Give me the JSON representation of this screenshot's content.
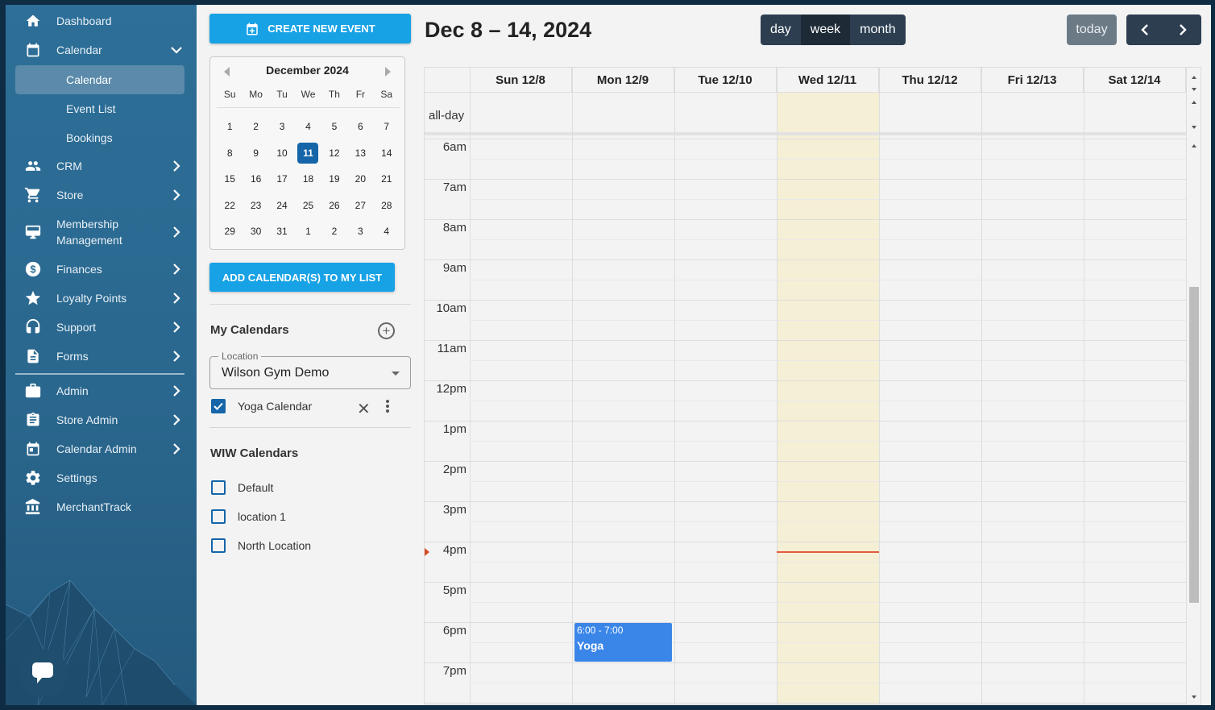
{
  "sidebar": {
    "items": [
      {
        "label": "Dashboard",
        "icon": "home-icon"
      },
      {
        "label": "Calendar",
        "icon": "calendar-icon",
        "expanded": true,
        "children": [
          {
            "label": "Calendar",
            "active": true
          },
          {
            "label": "Event List"
          },
          {
            "label": "Bookings"
          }
        ]
      },
      {
        "label": "CRM",
        "icon": "people-icon"
      },
      {
        "label": "Store",
        "icon": "cart-icon"
      },
      {
        "label": "Membership Management",
        "label_line1": "Membership",
        "label_line2": "Management",
        "icon": "monitor-icon"
      },
      {
        "label": "Finances",
        "icon": "dollar-circle-icon"
      },
      {
        "label": "Loyalty Points",
        "icon": "star-icon"
      },
      {
        "label": "Support",
        "icon": "headset-icon"
      },
      {
        "label": "Forms",
        "icon": "document-icon"
      },
      {
        "label": "Admin",
        "icon": "briefcase-icon"
      },
      {
        "label": "Store Admin",
        "icon": "clipboard-icon"
      },
      {
        "label": "Calendar Admin",
        "icon": "calendar-edit-icon"
      },
      {
        "label": "Settings",
        "icon": "gear-icon"
      },
      {
        "label": "MerchantTrack",
        "icon": "bank-icon"
      }
    ]
  },
  "toolbar": {
    "create_event_label": "CREATE NEW EVENT",
    "add_calendars_label": "ADD CALENDAR(S) TO MY LIST"
  },
  "mini_calendar": {
    "month_label": "December 2024",
    "weekdays": [
      "Su",
      "Mo",
      "Tu",
      "We",
      "Th",
      "Fr",
      "Sa"
    ],
    "days": [
      "1",
      "2",
      "3",
      "4",
      "5",
      "6",
      "7",
      "8",
      "9",
      "10",
      "11",
      "12",
      "13",
      "14",
      "15",
      "16",
      "17",
      "18",
      "19",
      "20",
      "21",
      "22",
      "23",
      "24",
      "25",
      "26",
      "27",
      "28",
      "29",
      "30",
      "31",
      "1",
      "2",
      "3",
      "4"
    ],
    "selected_day": "11"
  },
  "my_calendars": {
    "title": "My Calendars",
    "location_label": "Location",
    "location_value": "Wilson Gym Demo",
    "items": [
      {
        "label": "Yoga Calendar",
        "checked": true
      }
    ]
  },
  "wiw_calendars": {
    "title": "WIW Calendars",
    "items": [
      {
        "label": "Default",
        "checked": false
      },
      {
        "label": "location 1",
        "checked": false
      },
      {
        "label": "North Location",
        "checked": false
      }
    ]
  },
  "header": {
    "range_title": "Dec 8 – 14, 2024",
    "views": [
      "day",
      "week",
      "month"
    ],
    "active_view": "week",
    "today_label": "today"
  },
  "week": {
    "columns": [
      "Sun 12/8",
      "Mon 12/9",
      "Tue 12/10",
      "Wed 12/11",
      "Thu 12/12",
      "Fri 12/13",
      "Sat 12/14"
    ],
    "today_index": 3,
    "allday_label": "all-day",
    "hours": [
      "6am",
      "7am",
      "8am",
      "9am",
      "10am",
      "11am",
      "12pm",
      "1pm",
      "2pm",
      "3pm",
      "4pm",
      "5pm",
      "6pm",
      "7pm"
    ],
    "now_hour_index": 10,
    "events": [
      {
        "time": "6:00 - 7:00",
        "title": "Yoga",
        "day_index": 1,
        "start_hour_index": 12
      }
    ]
  },
  "colors": {
    "primary_button": "#17a2e6",
    "selected_day": "#1565a8",
    "event": "#3a86e8",
    "today_column": "#f5efd6",
    "now_indicator": "#e45b3a",
    "sidebar": "#2d6f98"
  }
}
